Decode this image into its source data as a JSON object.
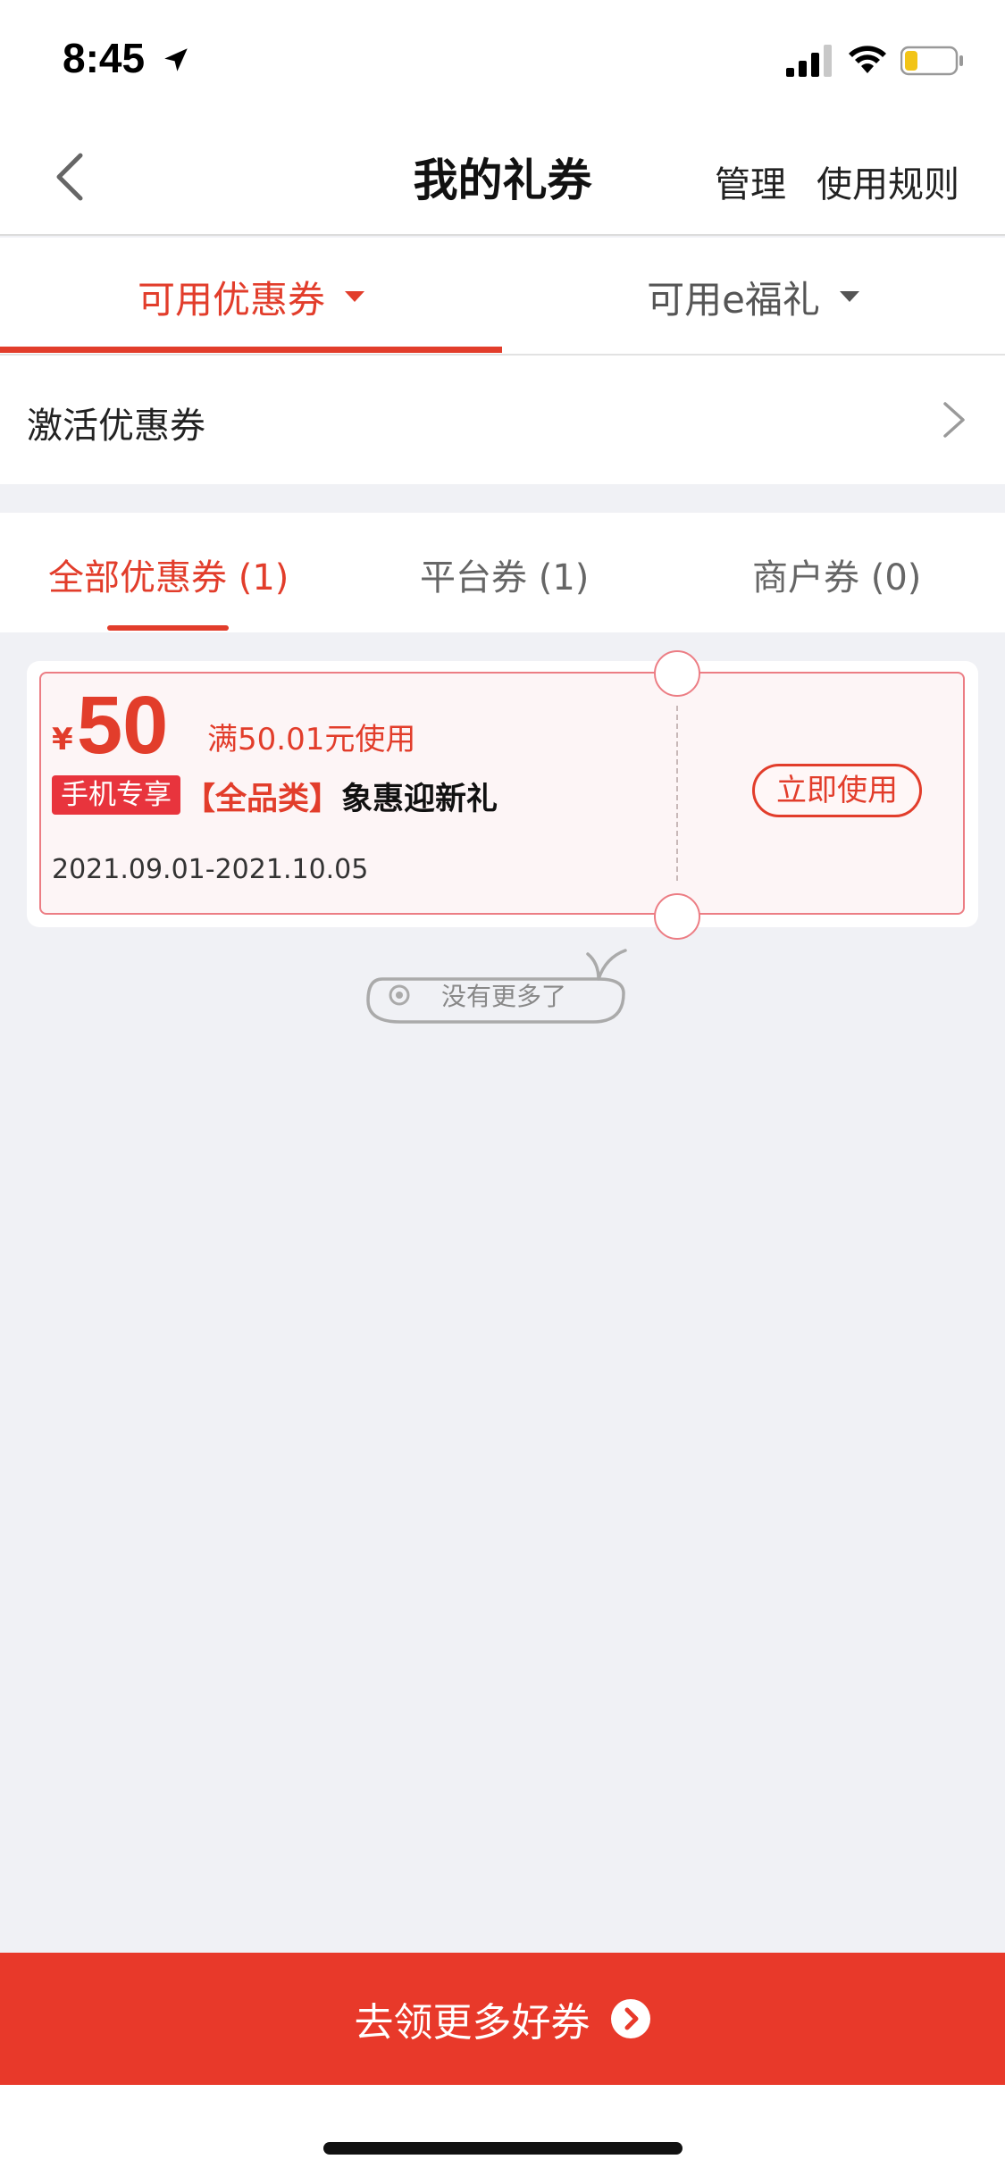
{
  "status_bar": {
    "time": "8:45"
  },
  "nav": {
    "title": "我的礼券",
    "manage": "管理",
    "rules": "使用规则"
  },
  "top_tabs": [
    {
      "label": "可用优惠券",
      "active": true
    },
    {
      "label": "可用e福礼",
      "active": false
    }
  ],
  "activate": {
    "label": "激活优惠券"
  },
  "sub_tabs": [
    {
      "label": "全部优惠券 (1)",
      "active": true
    },
    {
      "label": "平台券 (1)",
      "active": false
    },
    {
      "label": "商户券 (0)",
      "active": false
    }
  ],
  "coupon": {
    "currency": "¥",
    "amount": "50",
    "condition": "满50.01元使用",
    "tag": "手机专享",
    "category": "【全品类】",
    "name": "象惠迎新礼",
    "date_range": "2021.09.01-2021.10.05",
    "use_button": "立即使用"
  },
  "footer_note": "没有更多了",
  "bottom_button": {
    "label": "去领更多好券"
  },
  "colors": {
    "accent": "#e23d2b",
    "button_bg": "#e8392a",
    "page_bg": "#f0f1f5"
  }
}
